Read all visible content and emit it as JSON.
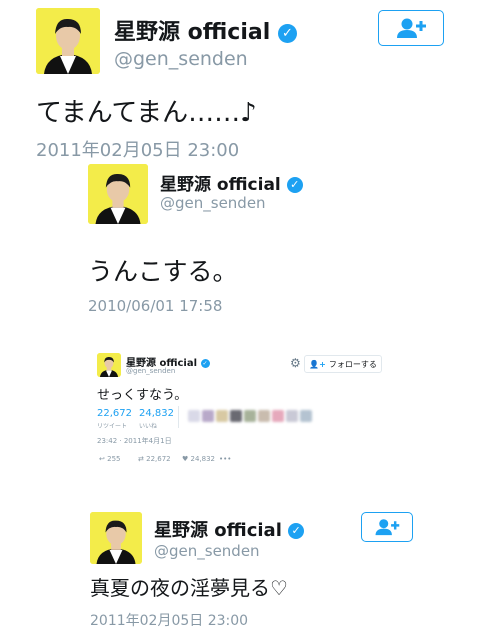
{
  "tweet1": {
    "name": "星野源 official",
    "handle": "@gen_senden",
    "text": "てまんてまん……♪",
    "timestamp": "2011年02月05日 23:00",
    "follow_icon": "add-user-icon"
  },
  "tweet2": {
    "name": "星野源 official",
    "handle": "@gen_senden",
    "text": "うんこする。",
    "timestamp": "2010/06/01 17:58"
  },
  "tweet3": {
    "name": "星野源 official",
    "handle": "@gen_senden",
    "text": "せっくすなう。",
    "follow_label": "フォローする",
    "retweets": "22,672",
    "retweets_label": "リツイート",
    "likes": "24,832",
    "likes_label": "いいね",
    "timestamp": "23:42 · 2011年4月1日",
    "reply_count": "255",
    "retweet_count": "22,672",
    "like_count": "24,832",
    "more_icon": "•••",
    "gear_icon": "⚙"
  },
  "tweet4": {
    "name": "星野源 official",
    "handle": "@gen_senden",
    "text": "真夏の夜の淫夢見る♡",
    "timestamp": "2011年02月05日 23:00",
    "follow_icon": "add-user-icon"
  },
  "colors": {
    "accent": "#1da1f2",
    "avatar_bg": "#f3ec4a",
    "muted": "#8899a6",
    "text": "#14171a"
  },
  "verified_icon": "verified-badge-icon"
}
